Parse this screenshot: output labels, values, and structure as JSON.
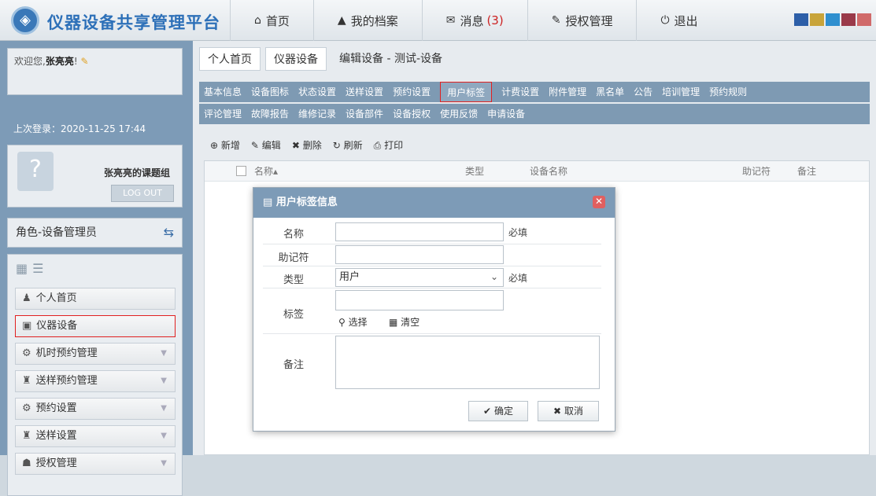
{
  "header": {
    "brand": "仪器设备共享管理平台",
    "nav": [
      {
        "label": "首页",
        "icon": "home-icon",
        "glyph": "⌂"
      },
      {
        "label": "我的档案",
        "icon": "user-icon",
        "glyph": "▲"
      },
      {
        "label": "消息",
        "count": "(3)",
        "icon": "mail-icon",
        "glyph": "✉"
      },
      {
        "label": "授权管理",
        "icon": "key-icon",
        "glyph": "✎"
      },
      {
        "label": "退出",
        "icon": "power-icon",
        "glyph": "⏻"
      }
    ]
  },
  "user": {
    "welcome": "欢迎您,",
    "name": "张亮亮",
    "suffix": "!",
    "last_login": "上次登录：2020-11-25 17:44",
    "group": "张亮亮的课题组",
    "logout": "LOG OUT",
    "role": "角色-设备管理员"
  },
  "menu": [
    {
      "label": "个人首页",
      "glyph": "♟"
    },
    {
      "label": "仪器设备",
      "glyph": "▣"
    },
    {
      "label": "机时预约管理",
      "glyph": "⚙"
    },
    {
      "label": "送样预约管理",
      "glyph": "♜"
    },
    {
      "label": "预约设置",
      "glyph": "⚙"
    },
    {
      "label": "送样设置",
      "glyph": "♜"
    },
    {
      "label": "授权管理",
      "glyph": "☗"
    }
  ],
  "breadcrumb": [
    "个人首页",
    "仪器设备",
    "编辑设备 - 测试-设备"
  ],
  "tabs_row1": [
    "基本信息",
    "设备图标",
    "状态设置",
    "送样设置",
    "预约设置",
    "用户标签",
    "计费设置",
    "附件管理",
    "黑名单",
    "公告",
    "培训管理",
    "预约规则"
  ],
  "tabs_row2": [
    "评论管理",
    "故障报告",
    "维修记录",
    "设备部件",
    "设备授权",
    "使用反馈",
    "申请设备"
  ],
  "toolbar": [
    "新增",
    "编辑",
    "删除",
    "刷新",
    "打印"
  ],
  "grid_columns": [
    "名称▴",
    "类型",
    "设备名称",
    "助记符",
    "备注"
  ],
  "modal": {
    "title": "用户标签信息",
    "name_label": "名称",
    "name_value": "",
    "required": "必填",
    "mnemonic_label": "助记符",
    "mnemonic_value": "",
    "type_label": "类型",
    "type_value": "用户",
    "tag_label": "标签",
    "select_label": "选择",
    "clear_label": "清空",
    "remark_label": "备注",
    "remark_value": "",
    "ok": "确定",
    "cancel": "取消"
  }
}
